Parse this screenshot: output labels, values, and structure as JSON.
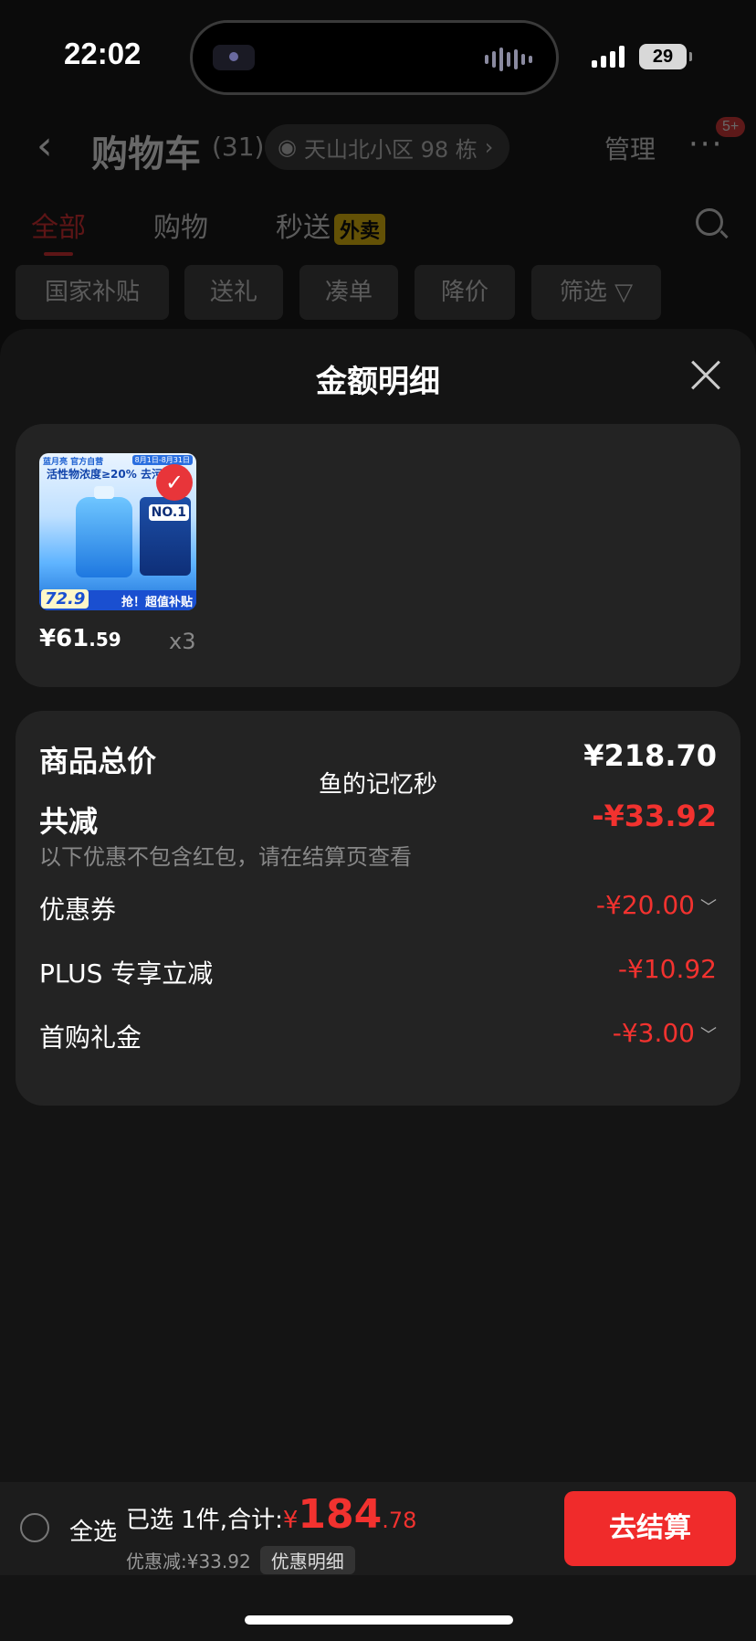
{
  "status": {
    "time": "22:02",
    "battery": "29"
  },
  "cart_header": {
    "title": "购物车",
    "count": "(31)",
    "address": "天山北小区 98 栋",
    "manage": "管理",
    "more": "···",
    "badge": "5+"
  },
  "tabs": [
    {
      "label": "全部",
      "active": true
    },
    {
      "label": "购物"
    },
    {
      "label": "秒送",
      "tag": "外卖"
    }
  ],
  "chips": [
    "国家补贴",
    "送礼",
    "凑单",
    "降价",
    "筛选"
  ],
  "sheet": {
    "title": "金额明细",
    "product": {
      "image_text": {
        "brand": "蓝月亮 官方自营",
        "date": "8月1日-8月31日",
        "headline": "活性物浓度≥20% 去污",
        "no1": "NO.1",
        "price": "72.9",
        "subsidy": "抢！超值补贴"
      },
      "price_main": "¥61",
      "price_dec": ".59",
      "qty": "x3"
    },
    "summary": {
      "total_label": "商品总价",
      "total_value": "¥218.70",
      "watermark": "鱼的记忆秒",
      "reduce_label": "共减",
      "reduce_value": "-¥33.92",
      "hint": "以下优惠不包含红包，请在结算页查看",
      "items": [
        {
          "label": "优惠券",
          "value": "-¥20.00",
          "expandable": true
        },
        {
          "label": "PLUS 专享立减",
          "value": "-¥10.92",
          "expandable": false
        },
        {
          "label": "首购礼金",
          "value": "-¥3.00",
          "expandable": true
        }
      ]
    }
  },
  "bottom_bar": {
    "select_all": "全选",
    "selected_prefix": "已选 1件,合计:",
    "currency": "¥",
    "total_int": "184",
    "total_dec": ".78",
    "discount_text": "优惠减:¥33.92",
    "detail_label": "优惠明细",
    "checkout": "去结算"
  },
  "colors": {
    "accent": "#f02b2b",
    "sheet_bg": "#141414",
    "card_bg": "#232323"
  }
}
